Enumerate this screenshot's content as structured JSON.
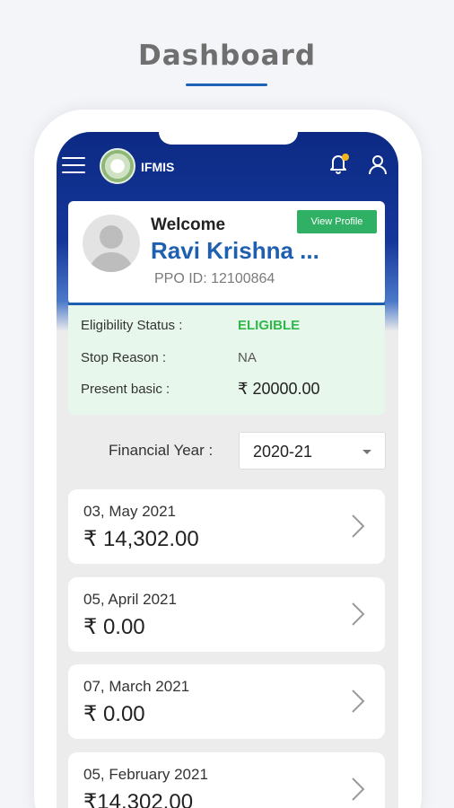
{
  "promo": {
    "title": "Dashboard"
  },
  "app": {
    "name": "IFMIS",
    "menu_icon": "hamburger-menu-icon",
    "notification_icon": "bell-icon",
    "profile_icon": "user-icon"
  },
  "profile": {
    "welcome": "Welcome",
    "name": "Ravi Krishna ...",
    "ppo_id": "PPO ID: 12100864",
    "view_profile_label": "View Profile"
  },
  "status": {
    "rows": [
      {
        "label": "Eligibility Status :",
        "value": "ELIGIBLE"
      },
      {
        "label": "Stop Reason :",
        "value": "NA"
      },
      {
        "label": "Present basic :",
        "value": "₹ 20000.00"
      }
    ]
  },
  "filter": {
    "label": "Financial Year :",
    "selected": "2020-21"
  },
  "payments": [
    {
      "date": "03, May 2021",
      "amount": "₹ 14,302.00"
    },
    {
      "date": "05, April 2021",
      "amount": "₹ 0.00"
    },
    {
      "date": "07, March 2021",
      "amount": "₹ 0.00"
    },
    {
      "date": "05, February 2021",
      "amount": "₹14,302.00"
    }
  ],
  "colors": {
    "header": "#0c2a84",
    "accent_blue": "#1e5fb0",
    "eligible_green": "#2fb84a",
    "button_green": "#2fb064",
    "status_bg": "#e8f7ec"
  }
}
